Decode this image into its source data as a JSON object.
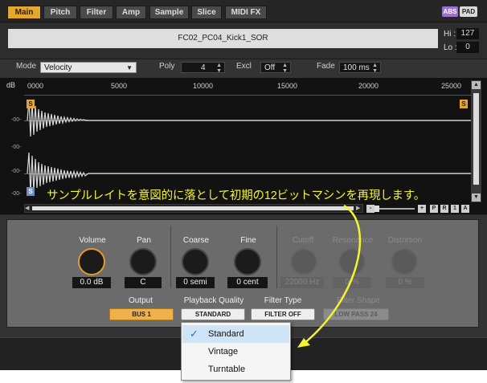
{
  "tabs": [
    {
      "label": "Main",
      "active": true
    },
    {
      "label": "Pitch"
    },
    {
      "label": "Filter"
    },
    {
      "label": "Amp"
    },
    {
      "label": "Sample"
    },
    {
      "label": "Slice"
    },
    {
      "label": "MIDI FX"
    }
  ],
  "badges": {
    "abs": "ABS",
    "pad": "PAD"
  },
  "sample": {
    "name": "FC02_PC04_Kick1_SOR",
    "hi_label": "Hi :",
    "hi_value": "127",
    "lo_label": "Lo :",
    "lo_value": "0"
  },
  "params": {
    "mode_label": "Mode",
    "mode_value": "Velocity",
    "poly_label": "Poly",
    "poly_value": "4",
    "excl_label": "Excl",
    "excl_value": "Off",
    "fade_label": "Fade",
    "fade_value": "100 ms"
  },
  "waveform": {
    "db_label": "dB",
    "ruler": [
      "0000",
      "5000",
      "10000",
      "15000",
      "20000",
      "25000"
    ],
    "y_labels": [
      "-00-",
      "-00-",
      "-00-",
      "-00-"
    ],
    "start_marker": "S",
    "end_marker": "S",
    "loop_marker": "S"
  },
  "scroll_buttons": [
    "-",
    "+",
    "P",
    "R",
    "1",
    "A"
  ],
  "annotation": "サンプルレイトを意図的に落として初期の12ビットマシンを再現します。",
  "knobs": [
    {
      "label": "Volume",
      "value": "0.0 dB",
      "enabled": true,
      "accent": true
    },
    {
      "label": "Pan",
      "value": "C",
      "enabled": true
    },
    {
      "label": "Coarse",
      "value": "0 semi",
      "enabled": true
    },
    {
      "label": "Fine",
      "value": "0 cent",
      "enabled": true
    },
    {
      "label": "Cutoff",
      "value": "22000 Hz",
      "enabled": false
    },
    {
      "label": "Resonance",
      "value": "0 %",
      "enabled": false
    },
    {
      "label": "Distortion",
      "value": "0 %",
      "enabled": false
    }
  ],
  "routing": [
    {
      "label": "Output",
      "value": "BUS 1"
    },
    {
      "label": "Playback Quality",
      "value": "STANDARD"
    },
    {
      "label": "Filter Type",
      "value": "FILTER OFF"
    },
    {
      "label": "Filter Shape",
      "value": "LOW PASS 24"
    }
  ],
  "dropdown": {
    "items": [
      {
        "label": "Standard",
        "checked": true
      },
      {
        "label": "Vintage"
      },
      {
        "label": "Turntable"
      }
    ]
  },
  "colors": {
    "accent": "#e5a82c",
    "annotation": "#f3f333",
    "selection": "#cfe4f7"
  },
  "icons": [
    "checkmark-icon",
    "dropdown-arrow-icon",
    "arrow-up-icon",
    "arrow-down-icon",
    "arrow-left-icon",
    "arrow-right-icon"
  ]
}
